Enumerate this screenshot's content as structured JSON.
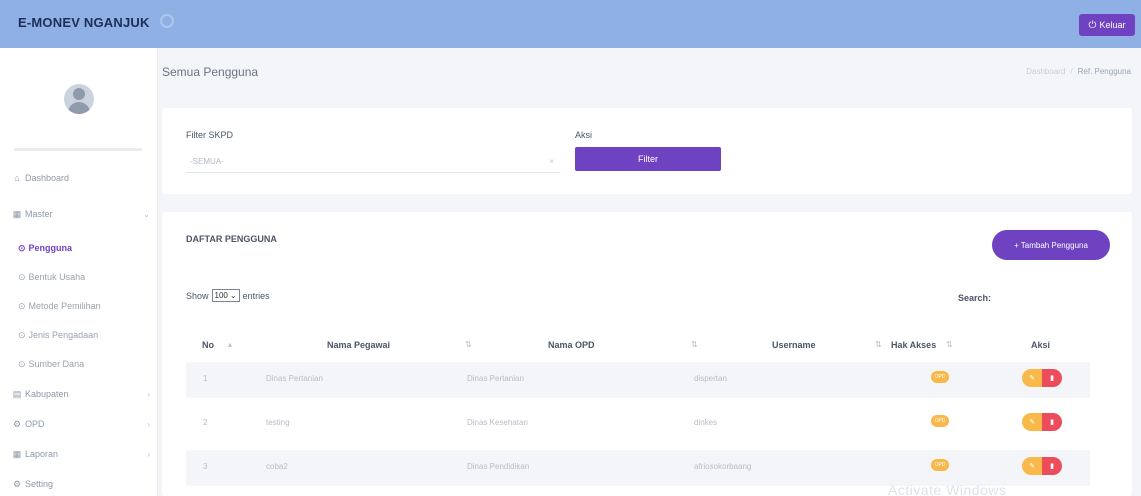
{
  "header": {
    "brand": "E-MONEV NGANJUK",
    "logout_label": "Keluar"
  },
  "sidebar": {
    "items": [
      {
        "label": "Dashboard",
        "icon": "home-icon"
      },
      {
        "label": "Master",
        "icon": "grid-icon"
      },
      {
        "label": "Kabupaten",
        "icon": "building-icon"
      },
      {
        "label": "OPD",
        "icon": "settings-icon"
      },
      {
        "label": "Laporan",
        "icon": "grid-icon"
      },
      {
        "label": "Setting",
        "icon": "settings-icon"
      }
    ],
    "master_sub": [
      "Pengguna",
      "Bentuk Usaha",
      "Metode Pemilihan",
      "Jenis Pengadaan",
      "Sumber Dana"
    ]
  },
  "page": {
    "title": "Semua Pengguna",
    "breadcrumb": [
      "Dashboard",
      "Ref. Pengguna"
    ]
  },
  "filter": {
    "skpd_label": "Filter SKPD",
    "skpd_value": "-SEMUA-",
    "aksi_label": "Aksi",
    "button": "Filter"
  },
  "list": {
    "title": "DAFTAR PENGGUNA",
    "add_button": "Tambah Pengguna",
    "show_label": "Show",
    "entries_value": "100",
    "entries_label": "entries",
    "search_label": "Search:",
    "columns": [
      "No",
      "Nama Pegawai",
      "Nama OPD",
      "Username",
      "Hak Akses",
      "Aksi"
    ],
    "rows": [
      {
        "no": "1",
        "nama": "Dinas Pertanian",
        "opd": "Dinas Pertanian",
        "username": "dispertan",
        "hak": "OPD"
      },
      {
        "no": "2",
        "nama": "testing",
        "opd": "Dinas Kesehatan",
        "username": "dinkes",
        "hak": "OPD"
      },
      {
        "no": "3",
        "nama": "coba2",
        "opd": "Dinas Pendidikan",
        "username": "afriosokorbaang",
        "hak": "OPD"
      }
    ]
  },
  "watermark": "Activate Windows"
}
